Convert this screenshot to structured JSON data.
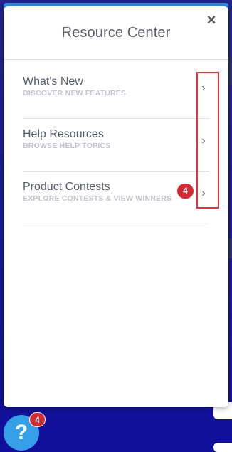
{
  "panel": {
    "title": "Resource Center",
    "close_label": "×"
  },
  "items": [
    {
      "label": "What's New",
      "subtitle": "DISCOVER NEW FEATURES",
      "chevron": "›"
    },
    {
      "label": "Help Resources",
      "subtitle": "BROWSE HELP TOPICS",
      "chevron": "›"
    },
    {
      "label": "Product Contests",
      "subtitle": "EXPLORE CONTESTS & VIEW WINNERS",
      "chevron": "›",
      "badge": "4"
    }
  ],
  "help_launcher": {
    "icon": "?",
    "badge": "4"
  },
  "colors": {
    "accent": "#3a86d8",
    "badge": "#d12a32",
    "launcher": "#35a0e8",
    "highlight": "#e2323e"
  }
}
